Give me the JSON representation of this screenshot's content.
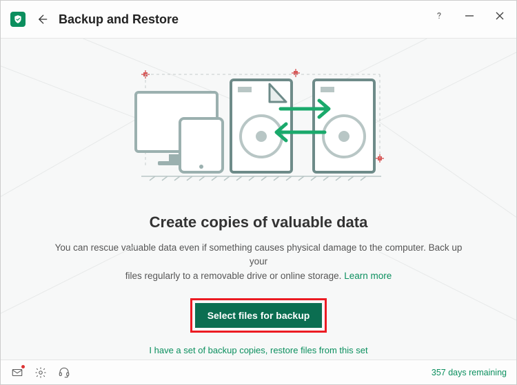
{
  "header": {
    "title": "Backup and Restore"
  },
  "main": {
    "heading": "Create copies of valuable data",
    "description_1": "You can rescue valuable data even if something causes physical damage to the computer. Back up your",
    "description_2": "files regularly to a removable drive or online storage.",
    "learn_more": "Learn more",
    "primary_button": "Select files for backup",
    "restore_link": "I have a set of backup copies, restore files from this set"
  },
  "footer": {
    "days_remaining": "357 days remaining"
  },
  "colors": {
    "accent": "#0b8f5e",
    "button": "#0b6e51",
    "highlight": "#ec1b23"
  }
}
